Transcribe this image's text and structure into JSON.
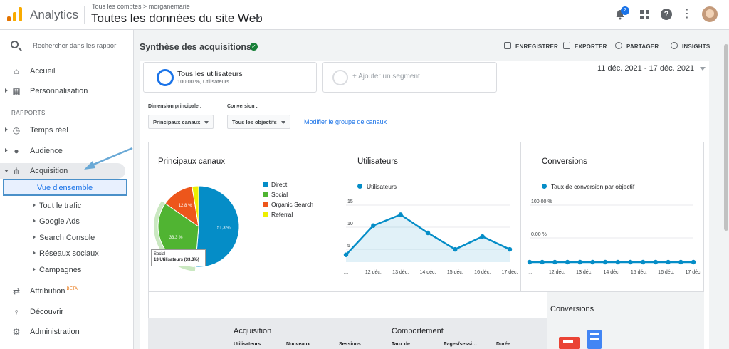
{
  "topbar": {
    "app_name": "Analytics",
    "breadcrumb": "Tous les comptes > morganemarie",
    "property": "Toutes les données du site Web",
    "notifications_count": "2"
  },
  "sidebar": {
    "search_placeholder": "Rechercher dans les rappor",
    "items": [
      {
        "label": "Accueil",
        "icon": "home-icon"
      },
      {
        "label": "Personnalisation",
        "icon": "dashboard-icon"
      }
    ],
    "section_label": "RAPPORTS",
    "reports": [
      {
        "label": "Temps réel",
        "icon": "clock-icon"
      },
      {
        "label": "Audience",
        "icon": "person-icon"
      },
      {
        "label": "Acquisition",
        "icon": "acquisition-icon"
      }
    ],
    "selected": "Vue d'ensemble",
    "subitems": [
      "Tout le trafic",
      "Google Ads",
      "Search Console",
      "Réseaux sociaux",
      "Campagnes"
    ],
    "bottom": [
      {
        "label": "Attribution",
        "badge": "BÊTA",
        "icon": "attribution-icon"
      },
      {
        "label": "Découvrir",
        "icon": "lightbulb-icon"
      },
      {
        "label": "Administration",
        "icon": "gear-icon"
      }
    ]
  },
  "header": {
    "title": "Synthèse des acquisitions",
    "actions": [
      "ENREGISTRER",
      "EXPORTER",
      "PARTAGER",
      "INSIGHTS"
    ]
  },
  "segments": {
    "primary_title": "Tous les utilisateurs",
    "primary_sub": "100,00 %, Utilisateurs",
    "add_label": "+ Ajouter un segment"
  },
  "date_range": "11 déc. 2021 - 17 déc. 2021",
  "filters": {
    "dimension_label": "Dimension principale :",
    "dimension_value": "Principaux canaux",
    "conversion_label": "Conversion :",
    "conversion_value": "Tous les objectifs",
    "modify_link": "Modifier le groupe de canaux"
  },
  "cards": {
    "channels_title": "Principaux canaux",
    "users_title": "Utilisateurs",
    "conversions_title": "Conversions",
    "users_series": "Utilisateurs",
    "conversions_series": "Taux de conversion par objectif",
    "tooltip_line1": "Social",
    "tooltip_line2": "13 Utilisateurs (33,3%)"
  },
  "colors": {
    "direct": "#058dc7",
    "social": "#50b432",
    "organic": "#ed561b",
    "referral": "#edef00",
    "accent": "#1a73e8"
  },
  "chart_data": [
    {
      "type": "pie",
      "title": "Principaux canaux",
      "categories": [
        "Direct",
        "Social",
        "Organic Search",
        "Referral"
      ],
      "values": [
        51.3,
        33.3,
        12.8,
        2.6
      ],
      "labels": [
        "51,3 %",
        "33,3 %",
        "12,8 %",
        ""
      ]
    },
    {
      "type": "area",
      "title": "Utilisateurs",
      "x": [
        "11 déc.",
        "12 déc.",
        "13 déc.",
        "14 déc.",
        "15 déc.",
        "16 déc.",
        "17 déc."
      ],
      "x_tick_labels": [
        "…",
        "12 déc.",
        "13 déc.",
        "14 déc.",
        "15 déc.",
        "16 déc.",
        "17 déc."
      ],
      "series": [
        {
          "name": "Utilisateurs",
          "values": [
            2,
            10,
            13,
            8,
            3.5,
            7,
            3.5
          ]
        }
      ],
      "y_ticks": [
        "15",
        "10",
        "5"
      ],
      "ylim": [
        0,
        16
      ]
    },
    {
      "type": "line",
      "title": "Conversions",
      "x": [
        "11 déc.",
        "12 déc.",
        "13 déc.",
        "14 déc.",
        "15 déc.",
        "16 déc.",
        "17 déc."
      ],
      "x_tick_labels": [
        "…",
        "12 déc.",
        "13 déc.",
        "14 déc.",
        "15 déc.",
        "16 déc.",
        "17 déc."
      ],
      "series": [
        {
          "name": "Taux de conversion par objectif",
          "values": [
            0,
            0,
            0,
            0,
            0,
            0,
            0,
            0,
            0,
            0,
            0,
            0,
            0,
            0
          ]
        }
      ],
      "y_ticks": [
        "100,00 %",
        "0,00 %"
      ],
      "ylim": [
        0,
        100
      ]
    }
  ],
  "table": {
    "group1": "Acquisition",
    "group2": "Comportement",
    "columns": [
      "Utilisateurs",
      "Nouveaux",
      "Sessions",
      "Taux de",
      "Pages/sessi…",
      "Durée"
    ]
  },
  "conversions_box": {
    "title": "Conversions"
  }
}
